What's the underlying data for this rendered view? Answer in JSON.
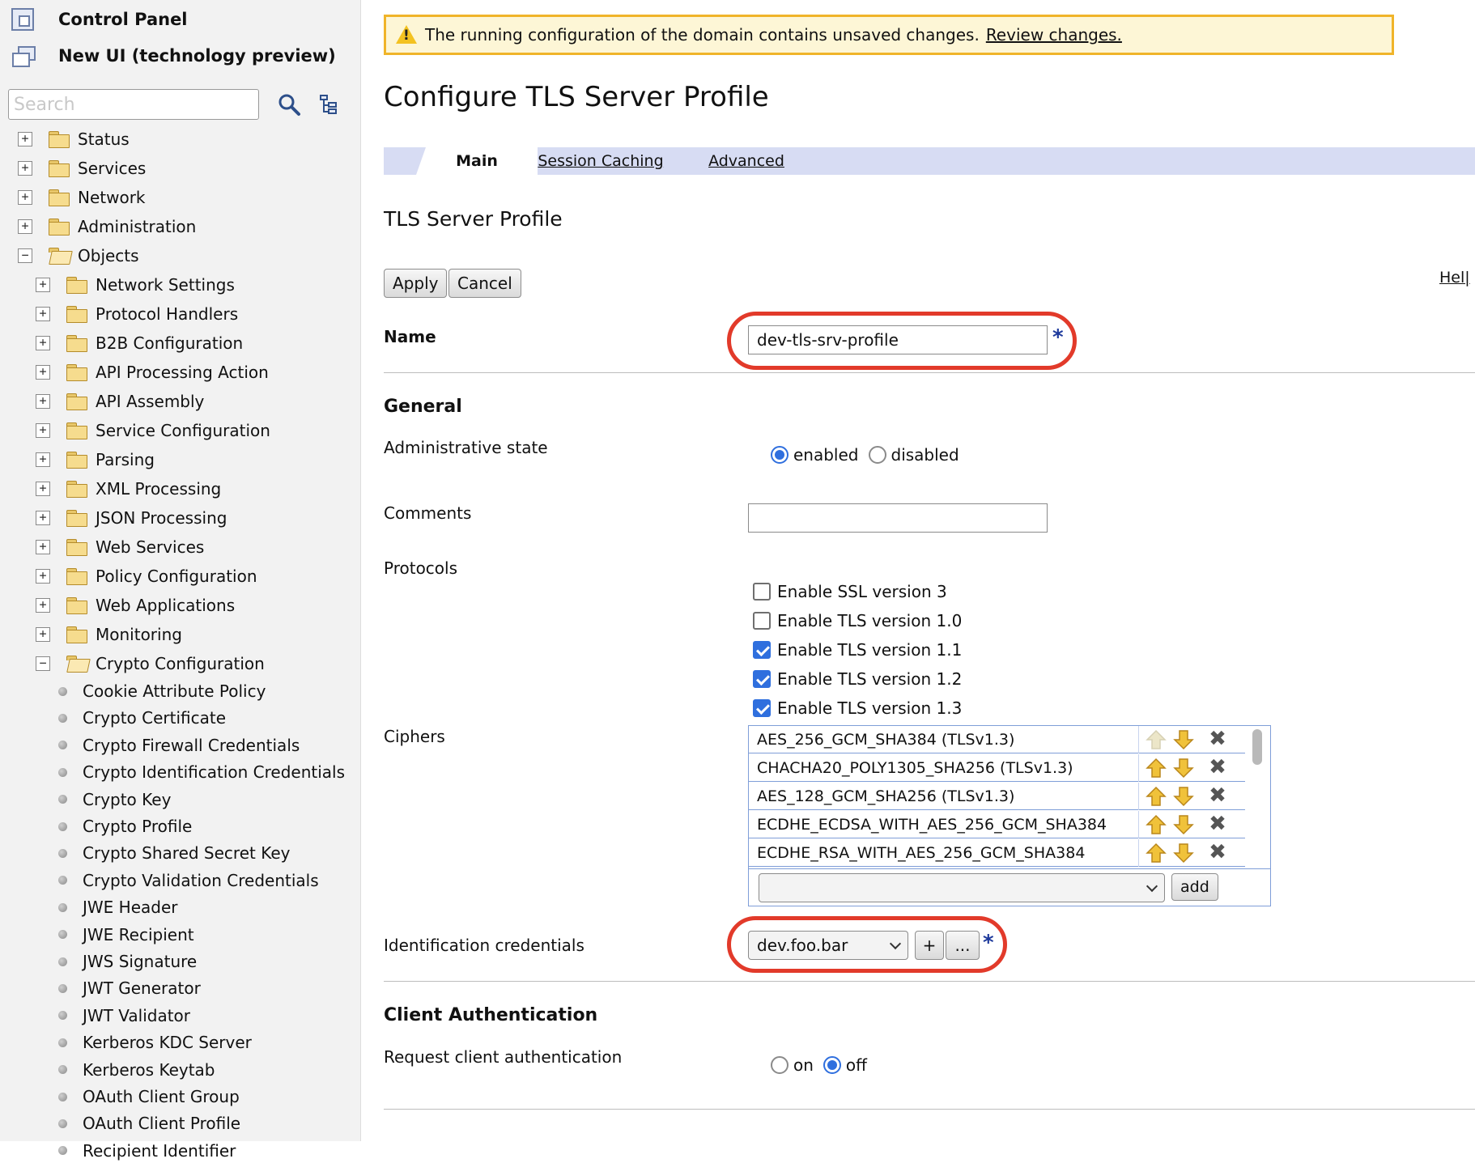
{
  "sidebar": {
    "control_panel": "Control Panel",
    "new_ui": "New UI (technology preview)",
    "search_placeholder": "Search",
    "top_items": [
      "Status",
      "Services",
      "Network",
      "Administration",
      "Objects"
    ],
    "objects_children": [
      "Network Settings",
      "Protocol Handlers",
      "B2B Configuration",
      "API Processing Action",
      "API Assembly",
      "Service Configuration",
      "Parsing",
      "XML Processing",
      "JSON Processing",
      "Web Services",
      "Policy Configuration",
      "Web Applications",
      "Monitoring",
      "Crypto Configuration"
    ],
    "crypto_children": [
      "Cookie Attribute Policy",
      "Crypto Certificate",
      "Crypto Firewall Credentials",
      "Crypto Identification Credentials",
      "Crypto Key",
      "Crypto Profile",
      "Crypto Shared Secret Key",
      "Crypto Validation Credentials",
      "JWE Header",
      "JWE Recipient",
      "JWS Signature",
      "JWT Generator",
      "JWT Validator",
      "Kerberos KDC Server",
      "Kerberos Keytab",
      "OAuth Client Group",
      "OAuth Client Profile",
      "Recipient Identifier"
    ]
  },
  "banner": {
    "message": "The running configuration of the domain contains unsaved changes.",
    "link": "Review changes."
  },
  "page_title": "Configure TLS Server Profile",
  "tabs": [
    "Main",
    "Session Caching",
    "Advanced"
  ],
  "section_title": "TLS Server Profile",
  "buttons": {
    "apply": "Apply",
    "cancel": "Cancel",
    "help": "Hel|"
  },
  "form": {
    "name_label": "Name",
    "name_value": "dev-tls-srv-profile",
    "required_mark": "*",
    "general_header": "General",
    "admin_state_label": "Administrative state",
    "admin_state_options": [
      "enabled",
      "disabled"
    ],
    "admin_state_selected": "enabled",
    "comments_label": "Comments",
    "comments_value": "",
    "protocols_label": "Protocols",
    "protocols": [
      {
        "label": "Enable SSL version 3",
        "checked": false
      },
      {
        "label": "Enable TLS version 1.0",
        "checked": false
      },
      {
        "label": "Enable TLS version 1.1",
        "checked": true
      },
      {
        "label": "Enable TLS version 1.2",
        "checked": true
      },
      {
        "label": "Enable TLS version 1.3",
        "checked": true
      }
    ],
    "ciphers_label": "Ciphers",
    "ciphers": [
      "AES_256_GCM_SHA384 (TLSv1.3)",
      "CHACHA20_POLY1305_SHA256 (TLSv1.3)",
      "AES_128_GCM_SHA256 (TLSv1.3)",
      "ECDHE_ECDSA_WITH_AES_256_GCM_SHA384",
      "ECDHE_RSA_WITH_AES_256_GCM_SHA384"
    ],
    "cipher_add": "add",
    "id_creds_label": "Identification credentials",
    "id_creds_value": "dev.foo.bar",
    "plus": "+",
    "ellipsis": "...",
    "client_auth_header": "Client Authentication",
    "request_client_auth_label": "Request client authentication",
    "client_auth_options": [
      "on",
      "off"
    ],
    "client_auth_selected": "off"
  },
  "colors": {
    "highlight_ring": "#e23a2a",
    "tab_bar": "#d7dcf3",
    "banner_border": "#f0b429",
    "accent_blue": "#2f6fde"
  }
}
